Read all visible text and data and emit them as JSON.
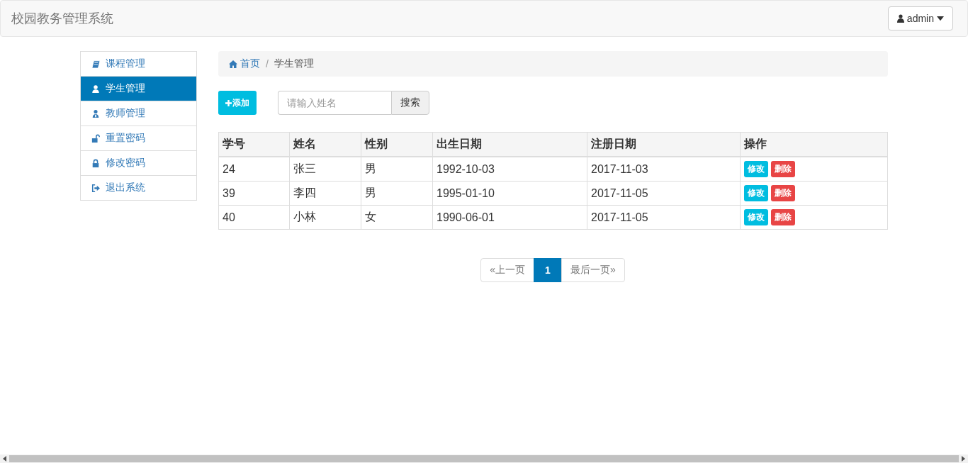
{
  "navbar": {
    "title": "校园教务管理系统",
    "user_menu": "admin"
  },
  "sidebar": {
    "items": [
      {
        "label": "课程管理",
        "kind": "book",
        "selected": false
      },
      {
        "label": "学生管理",
        "kind": "user",
        "selected": true
      },
      {
        "label": "教师管理",
        "kind": "teacher",
        "selected": false
      },
      {
        "label": "重置密码",
        "kind": "unlock",
        "selected": false
      },
      {
        "label": "修改密码",
        "kind": "lock",
        "selected": false
      },
      {
        "label": "退出系统",
        "kind": "logout",
        "selected": false
      }
    ]
  },
  "breadcrumb": [
    {
      "label": "首页",
      "kind": "home"
    },
    {
      "label": "学生管理",
      "kind": "current"
    }
  ],
  "breadcrumb_separator": "/",
  "toolbar": {
    "add_button": "添加",
    "search": {
      "placeholder": "请输入姓名"
    },
    "search_button": "搜索"
  },
  "table": {
    "columns": [
      "学号",
      "姓名",
      "性别",
      "出生日期",
      "注册日期",
      "操作"
    ],
    "rows": [
      {
        "cells": [
          "24",
          "张三",
          "男",
          "1992-10-03",
          "2017-11-03"
        ],
        "actions": [
          {
            "label": "修改",
            "kind": "edit"
          },
          {
            "label": "删除",
            "kind": "delete"
          }
        ]
      },
      {
        "cells": [
          "39",
          "李四",
          "男",
          "1995-01-10",
          "2017-11-05"
        ],
        "actions": [
          {
            "label": "修改",
            "kind": "edit"
          },
          {
            "label": "删除",
            "kind": "delete"
          }
        ]
      },
      {
        "cells": [
          "40",
          "小林",
          "女",
          "1990-06-01",
          "2017-11-05"
        ],
        "actions": [
          {
            "label": "修改",
            "kind": "edit"
          },
          {
            "label": "删除",
            "kind": "delete"
          }
        ]
      }
    ]
  },
  "pagination": [
    {
      "label": "«上一页",
      "selected": false
    },
    {
      "label": "1",
      "selected": true
    },
    {
      "label": "最后一页»",
      "selected": false
    }
  ]
}
